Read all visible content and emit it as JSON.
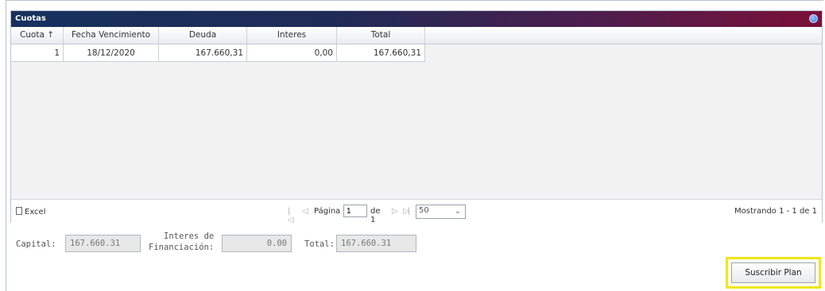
{
  "panel": {
    "title": "Cuotas"
  },
  "columns": [
    "Cuota ↑",
    "Fecha Vencimiento",
    "Deuda",
    "Interes",
    "Total"
  ],
  "rows": [
    {
      "cuota": "1",
      "fecha": "18/12/2020",
      "deuda": "167.660,31",
      "interes": "0,00",
      "total": "167.660,31"
    }
  ],
  "pager": {
    "excel_label": "Excel",
    "first": "|◁",
    "prev": "◁",
    "page_label": "Página",
    "page_value": "1",
    "of_label": "de 1",
    "next": "▷",
    "last": "▷|",
    "page_size": "50",
    "showing": "Mostrando 1 - 1 de 1"
  },
  "summary": {
    "capital_label": "Capital:",
    "capital_value": "167.660.31",
    "interes_label_1": "Interes de",
    "interes_label_2": "Financiación:",
    "interes_value": "0.00",
    "total_label": "Total:",
    "total_value": "167.660.31"
  },
  "actions": {
    "subscribe_label": "Suscribir Plan"
  },
  "colors": {
    "title_start": "#17315f",
    "title_end": "#7a1038",
    "highlight": "#f1e51a"
  },
  "icons": {
    "collapse": "collapse-circle-icon",
    "excel": "document-icon",
    "dropdown": "chevron-down-icon"
  }
}
